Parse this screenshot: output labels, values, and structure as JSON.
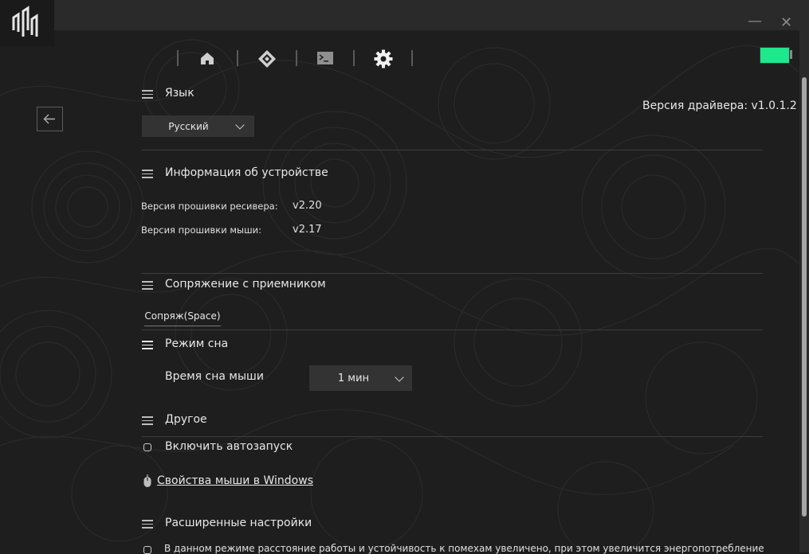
{
  "window": {
    "minimize_label": "—",
    "close_label": "✕"
  },
  "battery": {
    "level": 1.0,
    "color": "#1ee88c"
  },
  "nav": {
    "items": [
      "home-icon",
      "diamond-icon",
      "terminal-icon",
      "gear-icon"
    ],
    "active": "gear-icon"
  },
  "driver": {
    "version_text": "Версия драйвера: v1.0.1.2"
  },
  "language": {
    "title": "Язык",
    "selected": "Русский"
  },
  "device_info": {
    "title": "Информация об устройстве",
    "receiver_label": "Версия прошивки ресивера:",
    "receiver_value": "v2.20",
    "mouse_label": "Версия прошивки мыши:",
    "mouse_value": "v2.17"
  },
  "pairing": {
    "title": "Сопряжение с приемником",
    "button_label": "Сопряж(Space)"
  },
  "sleep": {
    "title": "Режим сна",
    "label": "Время сна мыши",
    "selected": "1 мин"
  },
  "other": {
    "title": "Другое",
    "autostart_label": "Включить автозапуск",
    "mouse_props_link": "Свойства мыши в Windows"
  },
  "advanced": {
    "title": "Расширенные настройки",
    "description": "В данном режиме расстояние работы и устойчивость к помехам увеличено, при этом увеличится энергопотребление"
  },
  "colors": {
    "accent": "#1ee88c",
    "background": "#1e1e1f",
    "titlebar": "#2a2a2b"
  }
}
